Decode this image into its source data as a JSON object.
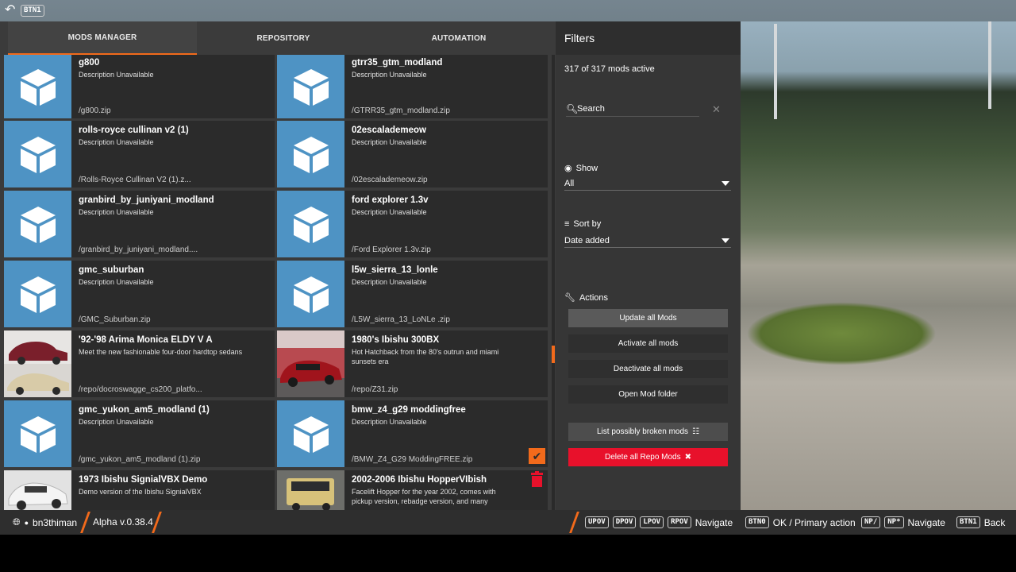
{
  "topbar": {
    "back_key": "BTN1"
  },
  "tabs": [
    {
      "label": "MODS MANAGER",
      "active": true
    },
    {
      "label": "REPOSITORY",
      "active": false
    },
    {
      "label": "AUTOMATION",
      "active": false
    }
  ],
  "mods": [
    {
      "title": "g800",
      "desc": "Description Unavailable",
      "path": "/g800.zip",
      "thumb": "box"
    },
    {
      "title": "gtrr35_gtm_modland",
      "desc": "Description Unavailable",
      "path": "/GTRR35_gtm_modland.zip",
      "thumb": "box"
    },
    {
      "title": "rolls-royce cullinan v2 (1)",
      "desc": "Description Unavailable",
      "path": "/Rolls-Royce Cullinan V2 (1).z...",
      "thumb": "box"
    },
    {
      "title": "02escalademeow",
      "desc": "Description Unavailable",
      "path": "/02escalademeow.zip",
      "thumb": "box"
    },
    {
      "title": "granbird_by_juniyani_modland",
      "desc": "Description Unavailable",
      "path": "/granbird_by_juniyani_modland....",
      "thumb": "box"
    },
    {
      "title": "ford explorer 1.3v",
      "desc": "Description Unavailable",
      "path": "/Ford Explorer 1.3v.zip",
      "thumb": "box"
    },
    {
      "title": "gmc_suburban",
      "desc": "Description Unavailable",
      "path": "/GMC_Suburban.zip",
      "thumb": "box"
    },
    {
      "title": "l5w_sierra_13_lonle",
      "desc": "Description Unavailable",
      "path": "/L5W_sierra_13_LoNLe .zip",
      "thumb": "box"
    },
    {
      "title": "'92-'98 Arima Monica ELDY V A",
      "desc": "Meet the new fashionable four-door hardtop sedans",
      "path": "/repo/docroswagge_cs200_platfo...",
      "thumb": "photo-sedan"
    },
    {
      "title": "1980's Ibishu 300BX",
      "desc": "Hot Hatchback from the 80's outrun and miami sunsets era",
      "path": "/repo/Z31.zip",
      "thumb": "photo-red"
    },
    {
      "title": "gmc_yukon_am5_modland (1)",
      "desc": "Description Unavailable",
      "path": "/gmc_yukon_am5_modland (1).zip",
      "thumb": "box"
    },
    {
      "title": "bmw_z4_g29 moddingfree",
      "desc": "Description Unavailable",
      "path": "/BMW_Z4_G29 ModdingFREE.zip",
      "thumb": "box"
    },
    {
      "title": "1973 Ibishu SignialVBX Demo",
      "desc": "Demo version of the Ibishu SignialVBX",
      "path": "",
      "thumb": "photo-white"
    },
    {
      "title": "2002-2006 Ibishu HopperVIbish",
      "desc": "Facelift Hopper for the year 2002, comes with pickup version, rebadge version, and many",
      "path": "",
      "thumb": "photo-yellow"
    }
  ],
  "filters": {
    "title": "Filters",
    "mods_active": "317 of 317 mods active",
    "search_label": "Search",
    "show_label": "Show",
    "show_value": "All",
    "sort_label": "Sort by",
    "sort_value": "Date added",
    "actions_label": "Actions",
    "buttons": {
      "update": "Update all Mods",
      "activate": "Activate all mods",
      "deactivate": "Deactivate all mods",
      "open_folder": "Open Mod folder",
      "broken": "List possibly broken mods",
      "delete_repo": "Delete all Repo Mods"
    }
  },
  "bottombar": {
    "user": "bn3thiman",
    "version": "Alpha v.0.38.4",
    "nav_keys": [
      "UPOV",
      "DPOV",
      "LPOV",
      "RPOV"
    ],
    "nav_label": "Navigate",
    "primary_key": "BTN0",
    "primary_label": "OK / Primary action",
    "np_keys": [
      "NP/",
      "NP*"
    ],
    "np_label": "Navigate",
    "back_key": "BTN1",
    "back_label": "Back"
  },
  "colors": {
    "accent": "#f26a1b",
    "danger": "#e8112b",
    "box_thumb": "#4e93c4"
  }
}
